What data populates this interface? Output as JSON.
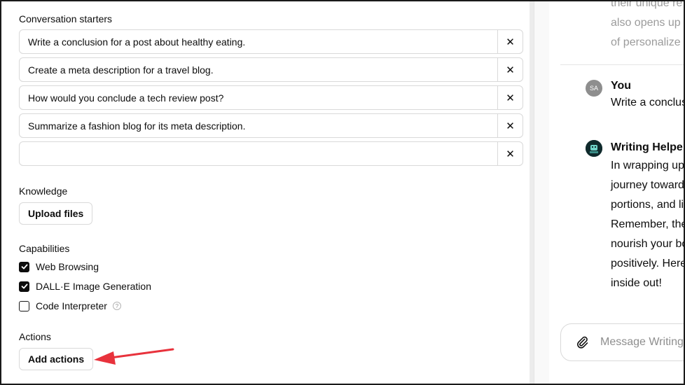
{
  "config": {
    "starters_title": "Conversation starters",
    "starters": [
      "Write a conclusion for a post about healthy eating.",
      "Create a meta description for a travel blog.",
      "How would you conclude a tech review post?",
      "Summarize a fashion blog for its meta description.",
      ""
    ],
    "remove_glyph": "✕",
    "knowledge_title": "Knowledge",
    "upload_label": "Upload files",
    "capabilities_title": "Capabilities",
    "capabilities": [
      {
        "label": "Web Browsing",
        "checked": true
      },
      {
        "label": "DALL·E Image Generation",
        "checked": true
      },
      {
        "label": "Code Interpreter",
        "checked": false
      }
    ],
    "help_glyph": "?",
    "actions_title": "Actions",
    "add_actions_label": "Add actions"
  },
  "preview": {
    "faded_lines": [
      "their unique re",
      "also opens up e",
      "of personalize"
    ],
    "user_initials": "SA",
    "user_name": "You",
    "user_message": "Write a conclus",
    "bot_name": "Writing Helper",
    "bot_lines": [
      "In wrapping up",
      "journey toward",
      "portions, and li",
      "Remember, the",
      "nourish your bo",
      "positively. Here",
      "inside out!"
    ],
    "composer_placeholder": "Message Writing"
  },
  "colors": {
    "annotation_arrow": "#e8323c",
    "checkbox_checked": "#0d0d0d"
  }
}
